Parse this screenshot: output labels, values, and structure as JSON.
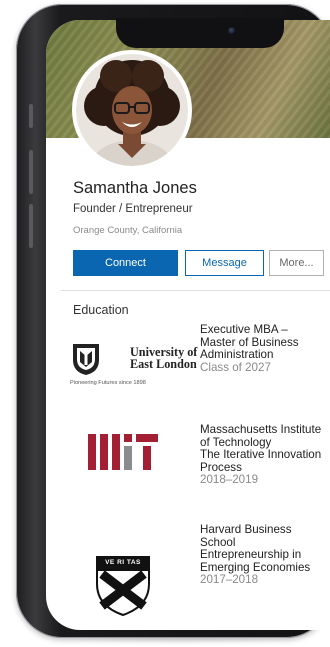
{
  "profile": {
    "name": "Samantha Jones",
    "title": "Founder / Entrepreneur",
    "location": "Orange County, California"
  },
  "actions": {
    "connect_label": "Connect",
    "message_label": "Message",
    "more_label": "More..."
  },
  "education": {
    "heading": "Education",
    "items": [
      {
        "logo_name": "university-of-east-london-logo",
        "logo_text_line1": "University of",
        "logo_text_line2": "East London",
        "logo_tagline": "Pioneering Futures since 1898",
        "degree": "Executive MBA – Master of Business Administration",
        "dates": "Class of 2027"
      },
      {
        "logo_name": "mit-logo",
        "school": "Massachusetts Institute of Technology",
        "program": "The Iterative Innovation Process",
        "dates": "2018–2019"
      },
      {
        "logo_name": "harvard-business-school-shield-logo",
        "logo_shield_text": "VE RI TAS",
        "school": "Harvard Business School",
        "program": "Entrepreneurship in Emerging Economies",
        "dates": "2017–2018"
      }
    ]
  },
  "colors": {
    "accent": "#0a66b0",
    "mit_red": "#a31f34",
    "mit_grey": "#8a8b8c",
    "harvard_crimson": "#a41034"
  }
}
